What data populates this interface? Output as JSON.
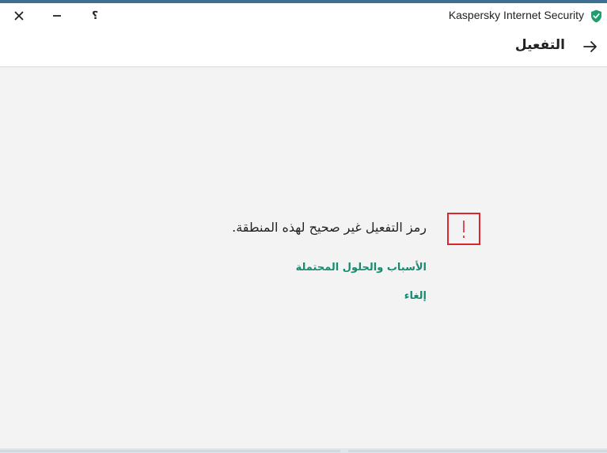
{
  "window": {
    "app_title": "Kaspersky Internet Security",
    "help_label": "؟",
    "accent_color": "#3c6f91"
  },
  "header": {
    "title": "التفعيل"
  },
  "main": {
    "error_message": "رمز التفعيل غير صحيح لهذه المنطقة.",
    "links": {
      "reasons": "الأسباب والحلول المحتملة",
      "cancel": "إلغاء"
    }
  },
  "colors": {
    "link": "#198a72",
    "error": "#d9272e",
    "shield": "#1f9e6e"
  },
  "icons": {
    "close": "close-icon",
    "minimize": "minimize-icon",
    "help": "help-icon",
    "shield": "shield-check-icon",
    "back": "arrow-right-icon",
    "error": "exclamation-icon"
  }
}
